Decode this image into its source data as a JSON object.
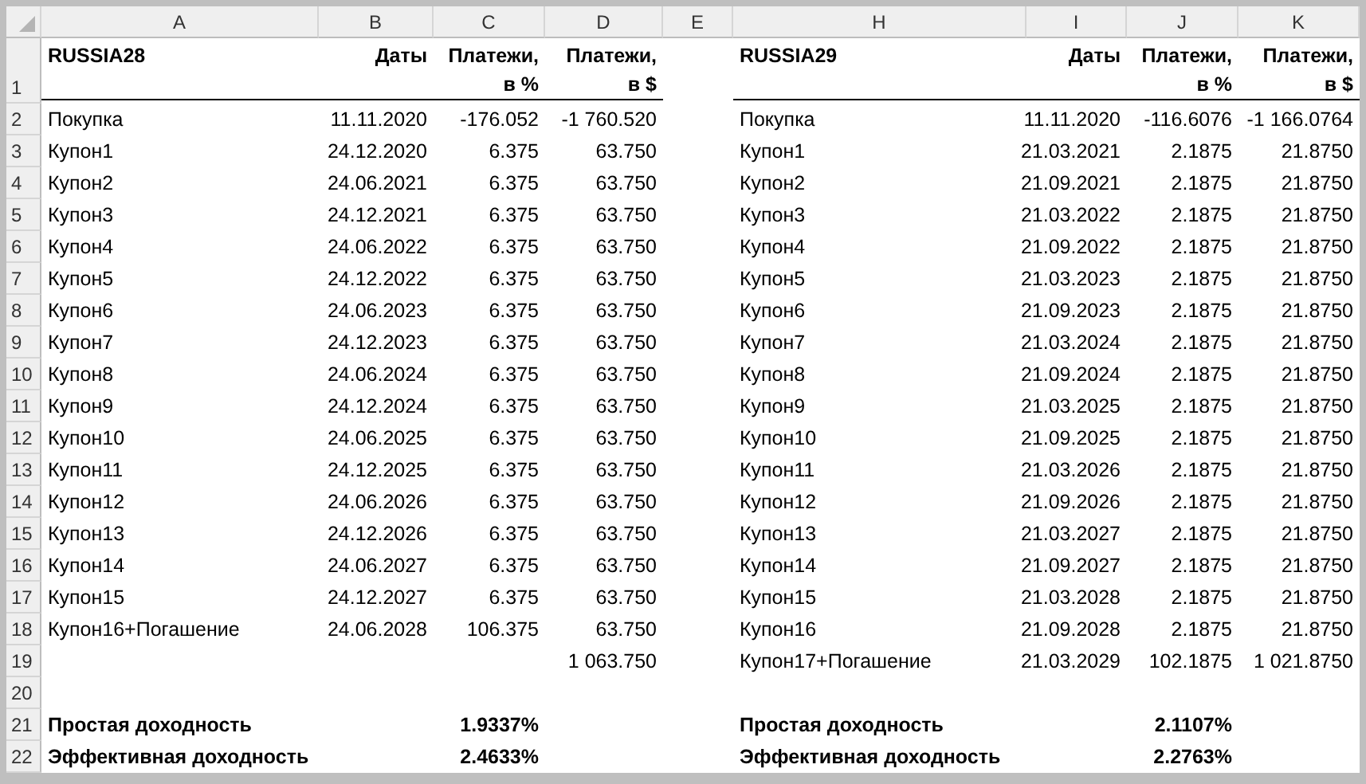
{
  "columns": [
    {
      "label": "A"
    },
    {
      "label": "B"
    },
    {
      "label": "C"
    },
    {
      "label": "D"
    },
    {
      "label": "E"
    },
    {
      "label": "H"
    },
    {
      "label": "I"
    },
    {
      "label": "J"
    },
    {
      "label": "K"
    }
  ],
  "rows": [
    {
      "number": "1",
      "kind": "header",
      "cells": {
        "A": "RUSSIA28",
        "B": "Даты",
        "C": "Платежи, в %",
        "D": "Платежи, в $",
        "H": "RUSSIA29",
        "I": "Даты",
        "J": "Платежи, в %",
        "K": "Платежи, в $"
      }
    },
    {
      "number": "2",
      "kind": "data",
      "cells": {
        "A": "Покупка",
        "B": "11.11.2020",
        "C": "-176.052",
        "D": "-1 760.520",
        "H": "Покупка",
        "I": "11.11.2020",
        "J": "-116.6076",
        "K": "-1 166.0764"
      }
    },
    {
      "number": "3",
      "kind": "data",
      "cells": {
        "A": "Купон1",
        "B": "24.12.2020",
        "C": "6.375",
        "D": "63.750",
        "H": "Купон1",
        "I": "21.03.2021",
        "J": "2.1875",
        "K": "21.8750"
      }
    },
    {
      "number": "4",
      "kind": "data",
      "cells": {
        "A": "Купон2",
        "B": "24.06.2021",
        "C": "6.375",
        "D": "63.750",
        "H": "Купон2",
        "I": "21.09.2021",
        "J": "2.1875",
        "K": "21.8750"
      }
    },
    {
      "number": "5",
      "kind": "data",
      "cells": {
        "A": "Купон3",
        "B": "24.12.2021",
        "C": "6.375",
        "D": "63.750",
        "H": "Купон3",
        "I": "21.03.2022",
        "J": "2.1875",
        "K": "21.8750"
      }
    },
    {
      "number": "6",
      "kind": "data",
      "cells": {
        "A": "Купон4",
        "B": "24.06.2022",
        "C": "6.375",
        "D": "63.750",
        "H": "Купон4",
        "I": "21.09.2022",
        "J": "2.1875",
        "K": "21.8750"
      }
    },
    {
      "number": "7",
      "kind": "data",
      "cells": {
        "A": "Купон5",
        "B": "24.12.2022",
        "C": "6.375",
        "D": "63.750",
        "H": "Купон5",
        "I": "21.03.2023",
        "J": "2.1875",
        "K": "21.8750"
      }
    },
    {
      "number": "8",
      "kind": "data",
      "cells": {
        "A": "Купон6",
        "B": "24.06.2023",
        "C": "6.375",
        "D": "63.750",
        "H": "Купон6",
        "I": "21.09.2023",
        "J": "2.1875",
        "K": "21.8750"
      }
    },
    {
      "number": "9",
      "kind": "data",
      "cells": {
        "A": "Купон7",
        "B": "24.12.2023",
        "C": "6.375",
        "D": "63.750",
        "H": "Купон7",
        "I": "21.03.2024",
        "J": "2.1875",
        "K": "21.8750"
      }
    },
    {
      "number": "10",
      "kind": "data",
      "cells": {
        "A": "Купон8",
        "B": "24.06.2024",
        "C": "6.375",
        "D": "63.750",
        "H": "Купон8",
        "I": "21.09.2024",
        "J": "2.1875",
        "K": "21.8750"
      }
    },
    {
      "number": "11",
      "kind": "data",
      "cells": {
        "A": "Купон9",
        "B": "24.12.2024",
        "C": "6.375",
        "D": "63.750",
        "H": "Купон9",
        "I": "21.03.2025",
        "J": "2.1875",
        "K": "21.8750"
      }
    },
    {
      "number": "12",
      "kind": "data",
      "cells": {
        "A": "Купон10",
        "B": "24.06.2025",
        "C": "6.375",
        "D": "63.750",
        "H": "Купон10",
        "I": "21.09.2025",
        "J": "2.1875",
        "K": "21.8750"
      }
    },
    {
      "number": "13",
      "kind": "data",
      "cells": {
        "A": "Купон11",
        "B": "24.12.2025",
        "C": "6.375",
        "D": "63.750",
        "H": "Купон11",
        "I": "21.03.2026",
        "J": "2.1875",
        "K": "21.8750"
      }
    },
    {
      "number": "14",
      "kind": "data",
      "cells": {
        "A": "Купон12",
        "B": "24.06.2026",
        "C": "6.375",
        "D": "63.750",
        "H": "Купон12",
        "I": "21.09.2026",
        "J": "2.1875",
        "K": "21.8750"
      }
    },
    {
      "number": "15",
      "kind": "data",
      "cells": {
        "A": "Купон13",
        "B": "24.12.2026",
        "C": "6.375",
        "D": "63.750",
        "H": "Купон13",
        "I": "21.03.2027",
        "J": "2.1875",
        "K": "21.8750"
      }
    },
    {
      "number": "16",
      "kind": "data",
      "cells": {
        "A": "Купон14",
        "B": "24.06.2027",
        "C": "6.375",
        "D": "63.750",
        "H": "Купон14",
        "I": "21.09.2027",
        "J": "2.1875",
        "K": "21.8750"
      }
    },
    {
      "number": "17",
      "kind": "data",
      "cells": {
        "A": "Купон15",
        "B": "24.12.2027",
        "C": "6.375",
        "D": "63.750",
        "H": "Купон15",
        "I": "21.03.2028",
        "J": "2.1875",
        "K": "21.8750"
      }
    },
    {
      "number": "18",
      "kind": "data",
      "cells": {
        "A": "Купон16+Погашение",
        "B": "24.06.2028",
        "C": "106.375",
        "D": "63.750",
        "H": "Купон16",
        "I": "21.09.2028",
        "J": "2.1875",
        "K": "21.8750"
      }
    },
    {
      "number": "19",
      "kind": "data",
      "cells": {
        "D": "1 063.750",
        "H": "Купон17+Погашение",
        "I": "21.03.2029",
        "J": "102.1875",
        "K": "1 021.8750"
      }
    },
    {
      "number": "20",
      "kind": "data"
    },
    {
      "number": "21",
      "kind": "summary",
      "cells": {
        "A": "Простая доходность",
        "C": "1.9337%",
        "H": "Простая доходность",
        "J": "2.1107%"
      }
    },
    {
      "number": "22",
      "kind": "summary",
      "cells": {
        "A": "Эффективная доходность",
        "C": "2.4633%",
        "H": "Эффективная доходность",
        "J": "2.2763%"
      }
    }
  ]
}
